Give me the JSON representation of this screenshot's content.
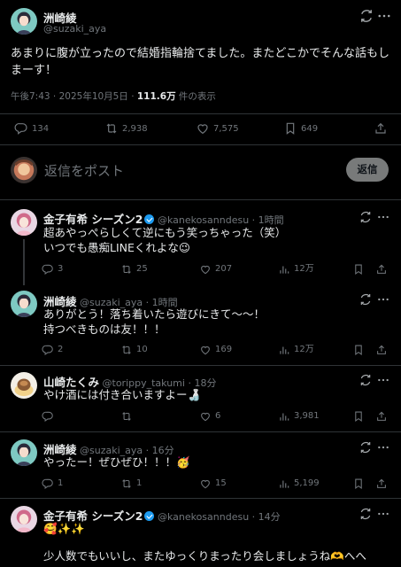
{
  "main_post": {
    "author_name": "洲崎綾",
    "author_handle": "@suzaki_aya",
    "text_line1": "あまりに腹が立ったので結婚指輪捨てました。またどこかでそんな話もし",
    "text_line2": "まーす！",
    "time": "午後7:43 · 2025年10月5日 · ",
    "views_value": "111.6万",
    "views_suffix": " 件の表示",
    "stats": {
      "replies": "134",
      "reposts": "2,938",
      "likes": "7,575",
      "bookmarks": "649"
    }
  },
  "composer": {
    "placeholder": "返信をポスト",
    "reply_button": "返信"
  },
  "replies": [
    {
      "name": "金子有希 シーズン2",
      "handle": "@kanekosanndesu",
      "time": "· 1時間",
      "line1": "超あやっぺらしくて逆にもう笑っちゃった（笑）",
      "line2": "いつでも愚痴LINEくれよな😉",
      "stats": {
        "replies": "3",
        "reposts": "25",
        "likes": "207",
        "views": "12万"
      }
    },
    {
      "name": "洲崎綾",
      "handle": "@suzaki_aya",
      "time": "· 1時間",
      "line1": "ありがとう！落ち着いたら遊びにきて〜〜！",
      "line2": "持つべきものは友！！！",
      "stats": {
        "replies": "2",
        "reposts": "10",
        "likes": "169",
        "views": "12万"
      }
    },
    {
      "name": "山崎たくみ",
      "handle": "@torippy_takumi",
      "time": "· 18分",
      "line1": "やけ酒には付き合いますよー🍶",
      "stats": {
        "replies": "",
        "reposts": "",
        "likes": "6",
        "views": "3,981"
      }
    },
    {
      "name": "洲崎綾",
      "handle": "@suzaki_aya",
      "time": "· 16分",
      "line1": "やったー！ぜひぜひ！！！🥳",
      "stats": {
        "replies": "1",
        "reposts": "1",
        "likes": "15",
        "views": "5,199"
      }
    },
    {
      "name": "金子有希 シーズン2",
      "handle": "@kanekosanndesu",
      "time": "· 14分",
      "line1": "🥰✨✨",
      "line3": "少人数でもいいし、またゆっくりまったり会しましょうね🫶へへ"
    }
  ],
  "icons": {
    "grok": "grok-icon",
    "more": "more-icon",
    "reply": "reply-icon",
    "repost": "repost-icon",
    "like": "like-icon",
    "bookmark": "bookmark-icon",
    "share": "share-icon",
    "views": "views-icon",
    "verified": "verified-badge-icon"
  },
  "colors": {
    "background": "#000000",
    "text": "#e7e9ea",
    "secondary": "#71767b",
    "divider": "#2f3336",
    "verified": "#1d9bf0"
  }
}
